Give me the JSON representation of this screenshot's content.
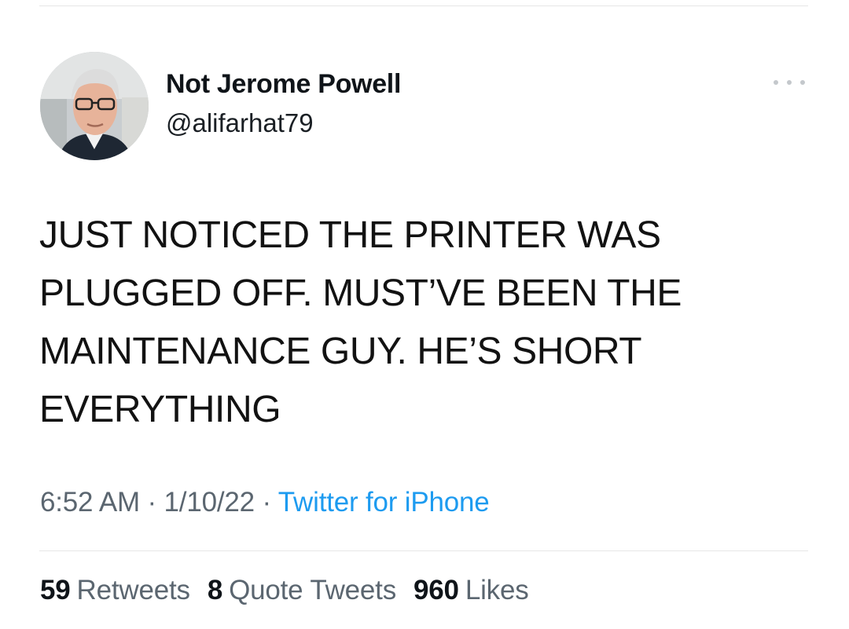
{
  "tweet": {
    "display_name": "Not Jerome Powell",
    "handle": "@alifarhat79",
    "text": "JUST NOTICED THE PRINTER WAS PLUGGED OFF. MUST’VE BEEN THE MAINTENANCE GUY. HE’S SHORT EVERYTHING",
    "time": "6:52 AM",
    "date": "1/10/22",
    "separator": "·",
    "source": "Twitter for iPhone",
    "more_icon": "more-horizontal-icon"
  },
  "stats": {
    "retweets_count": "59",
    "retweets_label": "Retweets",
    "quotes_count": "8",
    "quotes_label": "Quote Tweets",
    "likes_count": "960",
    "likes_label": "Likes"
  },
  "colors": {
    "link": "#1d9bf0",
    "secondary_text": "#5b6670",
    "primary_text": "#0f1419"
  }
}
